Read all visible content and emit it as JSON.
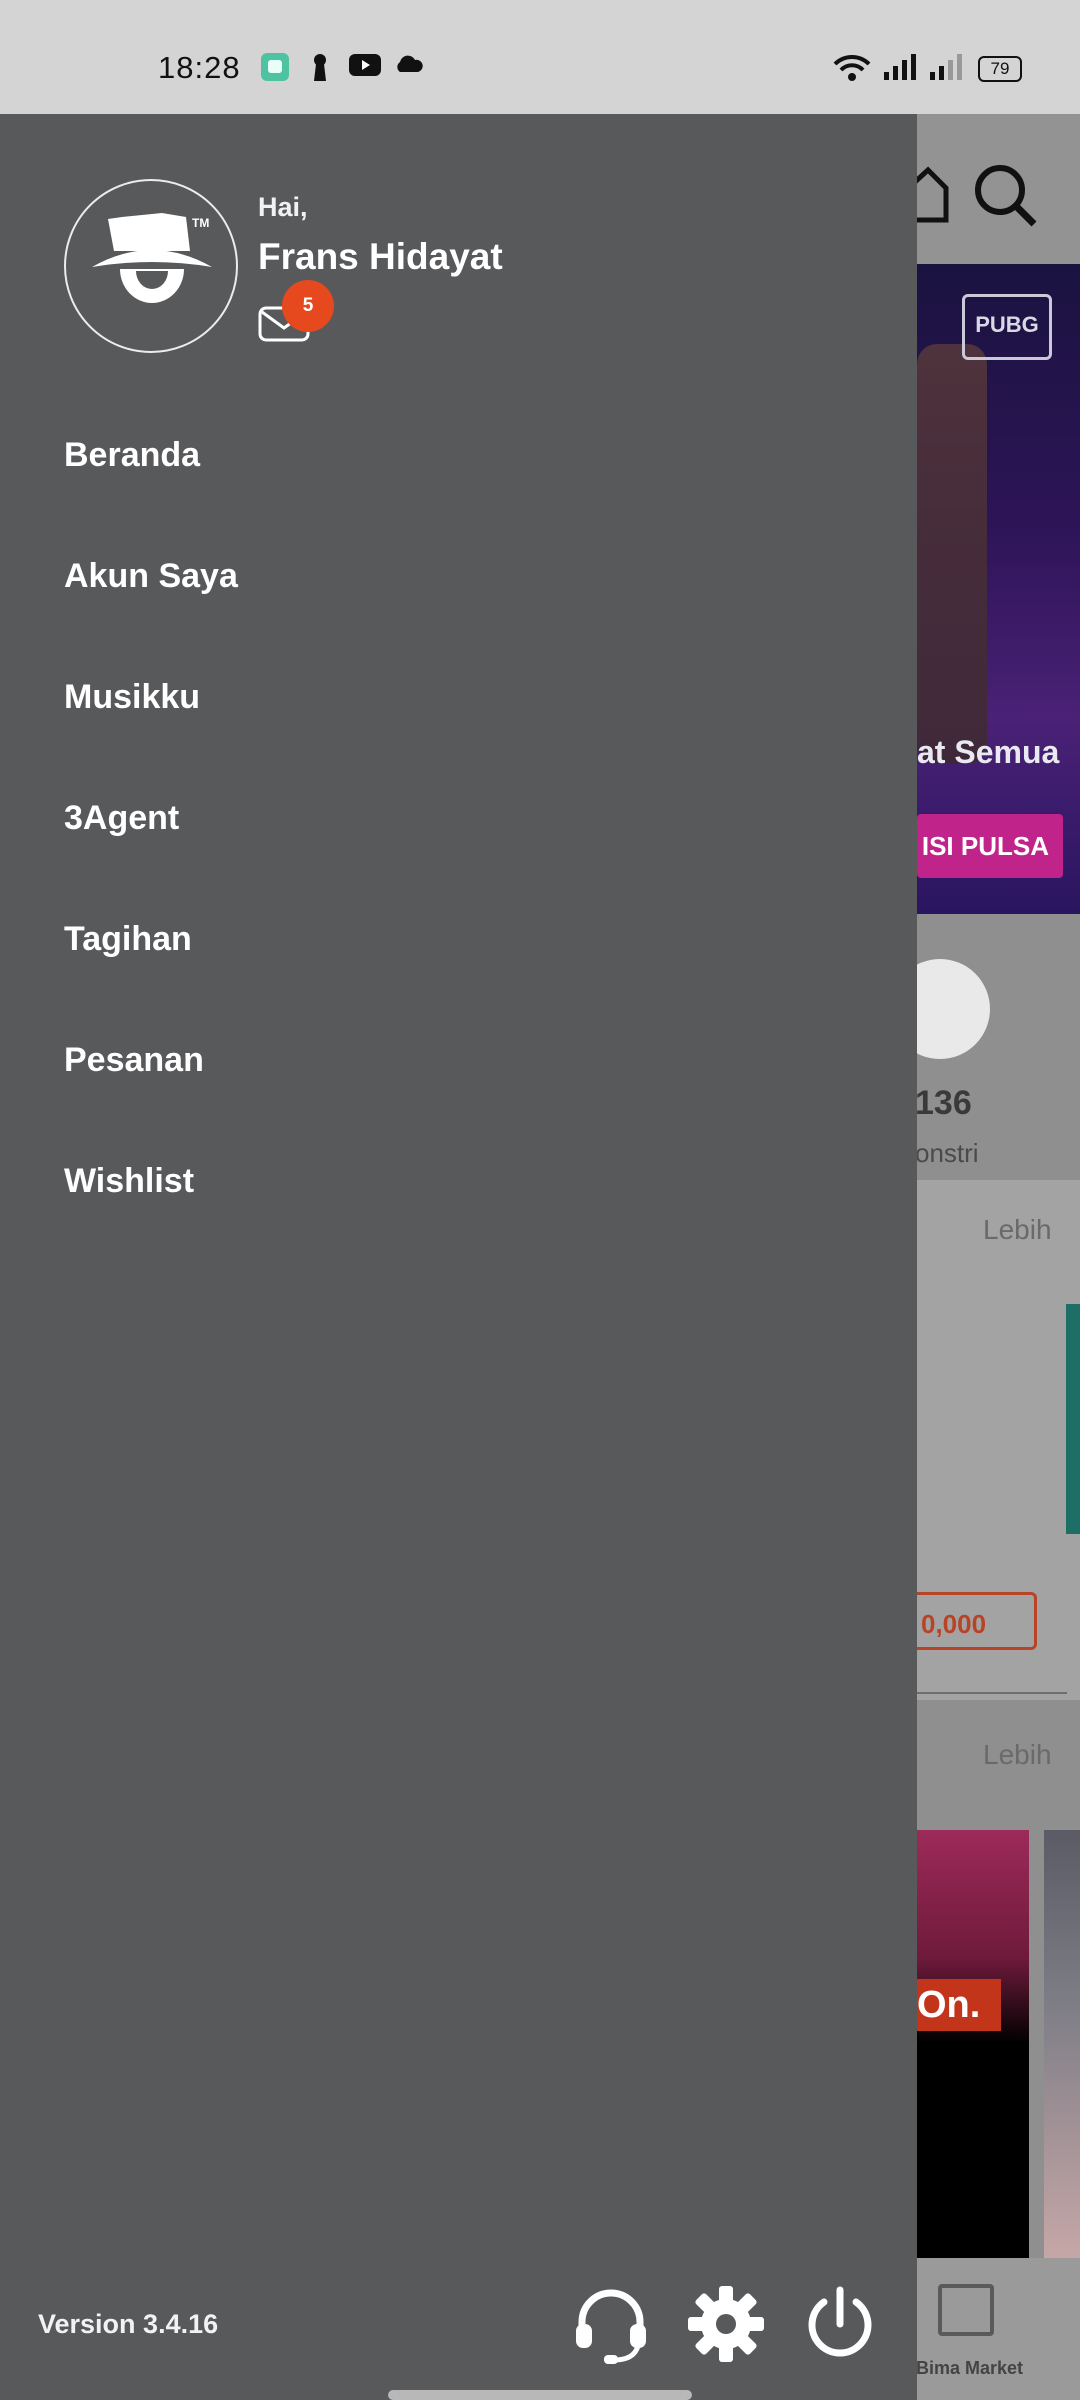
{
  "status_bar": {
    "time": "18:28",
    "battery": "79",
    "icons": [
      "chat-app-icon",
      "keyhole-icon",
      "youtube-icon",
      "cloud-icon",
      "wifi-icon",
      "signal-icon",
      "signal-weak-icon",
      "battery-icon"
    ]
  },
  "drawer": {
    "greeting": "Hai,",
    "user_name": "Frans Hidayat",
    "message_badge": "5",
    "menu_items": [
      {
        "label": "Beranda"
      },
      {
        "label": "Akun Saya"
      },
      {
        "label": "Musikku"
      },
      {
        "label": "3Agent"
      },
      {
        "label": "Tagihan"
      },
      {
        "label": "Pesanan"
      },
      {
        "label": "Wishlist"
      }
    ],
    "version": "Version 3.4.16",
    "bottom_icons": [
      "headset-icon",
      "settings-gear-icon",
      "power-icon"
    ]
  },
  "background_app": {
    "banner_label": "at Semua",
    "logo_text": "PUBG",
    "topup_button": "ISI PULSA",
    "stat_number": "136",
    "stat_label": "onstri",
    "more_link_1": "Lebih",
    "price_button": "0,000",
    "more_link_2": "Lebih",
    "promo_text": "On.",
    "nav_label": "Bima Market"
  },
  "colors": {
    "drawer_bg": "#58595b",
    "badge": "#e7491e",
    "accent_pink": "#c0238a"
  }
}
